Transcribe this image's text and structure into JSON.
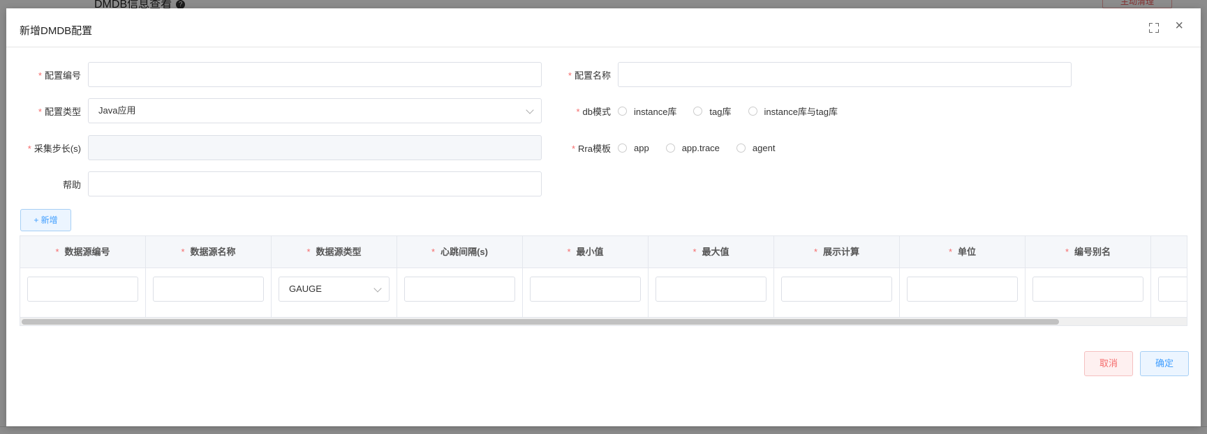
{
  "background": {
    "title": "DMDB信息查看",
    "help_icon": "question-icon",
    "clear_button": "主动清理"
  },
  "modal": {
    "title": "新增DMDB配置",
    "fullscreen_icon": "fullscreen-icon",
    "close_icon": "close-icon"
  },
  "form": {
    "config_no": {
      "label": "配置编号",
      "value": ""
    },
    "config_name": {
      "label": "配置名称",
      "value": ""
    },
    "config_type": {
      "label": "配置类型",
      "value": "Java应用"
    },
    "db_mode": {
      "label": "db模式",
      "options": [
        "instance库",
        "tag库",
        "instance库与tag库"
      ]
    },
    "step": {
      "label": "采集步长(s)",
      "value": ""
    },
    "rra_template": {
      "label": "Rra模板",
      "options": [
        "app",
        "app.trace",
        "agent"
      ]
    },
    "help": {
      "label": "帮助",
      "value": ""
    }
  },
  "add_button": "+ 新增",
  "table": {
    "columns": [
      "数据源编号",
      "数据源名称",
      "数据源类型",
      "心跳间隔(s)",
      "最小值",
      "最大值",
      "展示计算",
      "单位",
      "编号别名"
    ],
    "row": {
      "type_value": "GAUGE"
    }
  },
  "footer": {
    "cancel": "取消",
    "confirm": "确定"
  },
  "colors": {
    "required": "#f56c6c",
    "primary": "#409eff",
    "danger": "#f56c6c"
  }
}
